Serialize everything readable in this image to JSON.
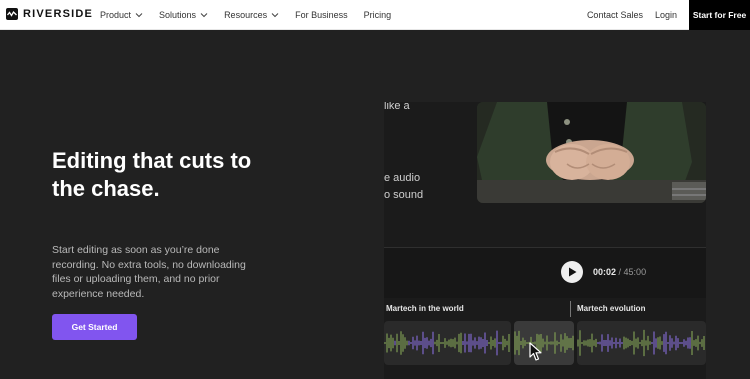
{
  "nav": {
    "brand": "RIVERSIDE",
    "links": [
      {
        "label": "Product",
        "has_dropdown": true
      },
      {
        "label": "Solutions",
        "has_dropdown": true
      },
      {
        "label": "Resources",
        "has_dropdown": true
      },
      {
        "label": "For Business",
        "has_dropdown": false
      },
      {
        "label": "Pricing",
        "has_dropdown": false
      }
    ],
    "contact_sales": "Contact Sales",
    "login": "Login",
    "start_for_free": "Start for Free"
  },
  "hero": {
    "title": "Editing that cuts to the chase.",
    "subtitle": "Start editing as soon as you’re done recording. No extra tools, no downloading files or uploading them, and no prior experience needed.",
    "cta": "Get Started"
  },
  "editor": {
    "transcript_lines": [
      "like a",
      "e audio",
      "o sound"
    ],
    "time_current": "00:02",
    "time_separator": " / ",
    "time_total": "45:00",
    "tracks": [
      "Martech in the world",
      "Martech evolution"
    ]
  },
  "colors": {
    "accent": "#8155ef",
    "background": "#212121",
    "wave_green": "#7c9a52",
    "wave_purple": "#7d66c9"
  },
  "icons": {
    "logo": "waveform-logo-icon",
    "dropdown": "chevron-down-icon",
    "play": "play-icon",
    "cursor": "mouse-pointer-icon"
  }
}
